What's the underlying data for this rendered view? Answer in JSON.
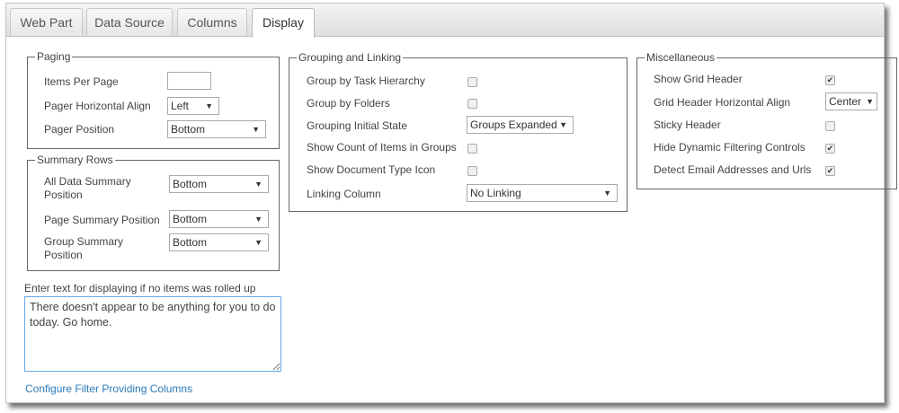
{
  "tabs": [
    {
      "label": "Web Part"
    },
    {
      "label": "Data Source"
    },
    {
      "label": "Columns"
    },
    {
      "label": "Display"
    }
  ],
  "paging": {
    "title": "Paging",
    "items_per_page_label": "Items Per Page",
    "items_per_page_value": "",
    "h_align_label": "Pager Horizontal Align",
    "h_align_value": "Left",
    "position_label": "Pager Position",
    "position_value": "Bottom"
  },
  "summary": {
    "title": "Summary Rows",
    "all_label": "All Data Summary Position",
    "all_value": "Bottom",
    "page_label": "Page Summary Position",
    "page_value": "Bottom",
    "group_label": "Group Summary Position",
    "group_value": "Bottom"
  },
  "grouping": {
    "title": "Grouping and Linking",
    "task_label": "Group by Task Hierarchy",
    "task_checked": false,
    "folders_label": "Group by Folders",
    "folders_checked": false,
    "initial_label": "Grouping Initial State",
    "initial_value": "Groups Expanded",
    "count_label": "Show Count of Items in Groups",
    "count_checked": false,
    "doctype_label": "Show Document Type Icon",
    "doctype_checked": false,
    "linking_label": "Linking Column",
    "linking_value": "No Linking"
  },
  "misc": {
    "title": "Miscellaneous",
    "grid_header_label": "Show Grid Header",
    "grid_header_checked": true,
    "header_align_label": "Grid Header Horizontal Align",
    "header_align_value": "Center",
    "sticky_label": "Sticky Header",
    "sticky_checked": false,
    "hide_filter_label": "Hide Dynamic Filtering Controls",
    "hide_filter_checked": true,
    "detect_label": "Detect Email Addresses and Urls",
    "detect_checked": true
  },
  "no_items": {
    "label": "Enter text for displaying if no items was rolled up",
    "value": "There doesn't appear to be anything for you to do today. Go home."
  },
  "link": "Configure Filter Providing Columns"
}
